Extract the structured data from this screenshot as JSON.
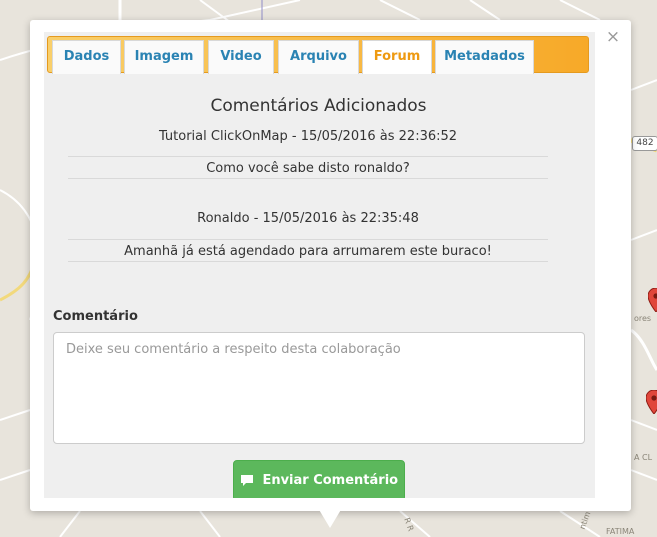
{
  "map": {
    "road_badge": "482",
    "street_labels": [
      "ores",
      "A CL",
      "R R",
      "ntim",
      "FATIMA"
    ]
  },
  "popup": {
    "close_icon": "close-icon",
    "tabs": [
      {
        "label": "Dados",
        "active": false
      },
      {
        "label": "Imagem",
        "active": false
      },
      {
        "label": "Video",
        "active": false
      },
      {
        "label": "Arquivo",
        "active": false
      },
      {
        "label": "Forum",
        "active": true
      },
      {
        "label": "Metadados",
        "active": false
      }
    ],
    "forum": {
      "title": "Comentários Adicionados",
      "comments": [
        {
          "author_date": "Tutorial ClickOnMap - 15/05/2016 às 22:36:52",
          "text": "Como você sabe disto ronaldo?"
        },
        {
          "author_date": "Ronaldo - 15/05/2016 às 22:35:48",
          "text": "Amanhã já está agendado para arrumarem este buraco!"
        }
      ],
      "form_label": "Comentário",
      "comment_placeholder": "Deixe seu comentário a respeito desta colaboração",
      "comment_value": "",
      "send_button": "Enviar Comentário",
      "send_icon": "comment-icon"
    }
  },
  "colors": {
    "tab_active": "#ee9a12",
    "tab_link": "#2a83b3",
    "tabbar": "#f7a928",
    "button": "#5cb85c"
  }
}
